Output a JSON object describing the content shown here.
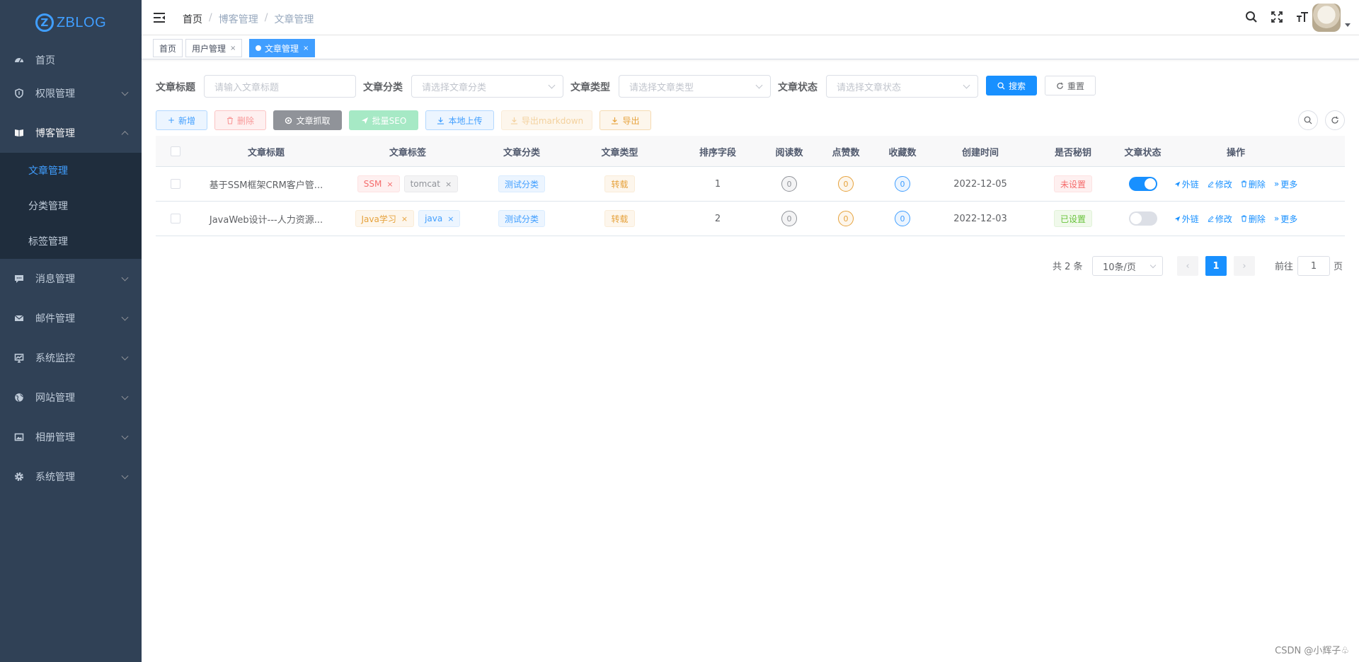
{
  "logo": {
    "mark": "Z",
    "text": "ZBLOG"
  },
  "sidebar": {
    "items": [
      {
        "label": "首页",
        "icon": "dashboard-icon"
      },
      {
        "label": "权限管理",
        "icon": "shield-icon"
      },
      {
        "label": "博客管理",
        "icon": "book-icon",
        "open": true,
        "children": [
          {
            "label": "文章管理",
            "active": true
          },
          {
            "label": "分类管理"
          },
          {
            "label": "标签管理"
          }
        ]
      },
      {
        "label": "消息管理",
        "icon": "chat-icon"
      },
      {
        "label": "邮件管理",
        "icon": "mail-icon"
      },
      {
        "label": "系统监控",
        "icon": "monitor-icon"
      },
      {
        "label": "网站管理",
        "icon": "globe-icon"
      },
      {
        "label": "相册管理",
        "icon": "picture-icon"
      },
      {
        "label": "系统管理",
        "icon": "gear-icon"
      }
    ]
  },
  "breadcrumb": [
    "首页",
    "博客管理",
    "文章管理"
  ],
  "tags": [
    {
      "label": "首页",
      "closable": false
    },
    {
      "label": "用户管理",
      "closable": true
    },
    {
      "label": "文章管理",
      "closable": true,
      "active": true
    }
  ],
  "search": {
    "title_label": "文章标题",
    "title_placeholder": "请输入文章标题",
    "category_label": "文章分类",
    "category_placeholder": "请选择文章分类",
    "type_label": "文章类型",
    "type_placeholder": "请选择文章类型",
    "status_label": "文章状态",
    "status_placeholder": "请选择文章状态",
    "search_btn": "搜索",
    "reset_btn": "重置"
  },
  "toolbar": {
    "add": "新增",
    "delete": "删除",
    "crawl": "文章抓取",
    "seo": "批量SEO",
    "upload": "本地上传",
    "export_md": "导出markdown",
    "export": "导出"
  },
  "table": {
    "headers": [
      "文章标题",
      "文章标签",
      "文章分类",
      "文章类型",
      "排序字段",
      "阅读数",
      "点赞数",
      "收藏数",
      "创建时间",
      "是否秘钥",
      "文章状态",
      "操作"
    ],
    "rows": [
      {
        "title": "基于SSM框架CRM客户管...",
        "tags": [
          {
            "name": "SSM",
            "style": "danger"
          },
          {
            "name": "tomcat",
            "style": "info"
          }
        ],
        "category": "测试分类",
        "type": "转载",
        "sort": "1",
        "reads": "0",
        "likes": "0",
        "favorites": "0",
        "created": "2022-12-05",
        "secret": "未设置",
        "secret_style": "danger",
        "status_on": true
      },
      {
        "title": "JavaWeb设计---人力资源...",
        "tags": [
          {
            "name": "Java学习",
            "style": "warn"
          },
          {
            "name": "java",
            "style": "primary"
          }
        ],
        "category": "测试分类",
        "type": "转载",
        "sort": "2",
        "reads": "0",
        "likes": "0",
        "favorites": "0",
        "created": "2022-12-03",
        "secret": "已设置",
        "secret_style": "success",
        "status_on": false
      }
    ],
    "actions": [
      "外链",
      "修改",
      "删除",
      "更多"
    ]
  },
  "pagination": {
    "total": "共 2 条",
    "page_size": "10条/页",
    "current": "1",
    "goto_label": "前往",
    "goto_value": "1",
    "page_suffix": "页"
  },
  "watermark": "CSDN @小辉子♧",
  "colors": {
    "sidebar_bg": "#304156",
    "primary": "#1890ff",
    "submenu_bg": "#1f2d3d"
  }
}
